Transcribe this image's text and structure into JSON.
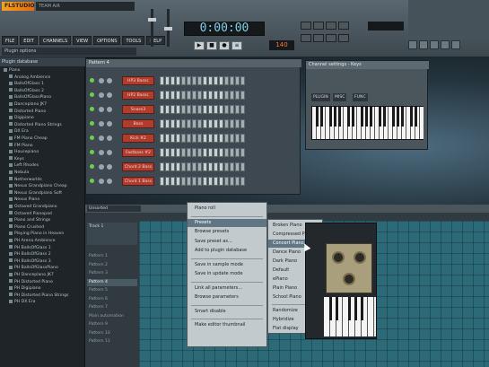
{
  "app": {
    "logo": "FLSTUDIO",
    "song_name": "TEAM AiR",
    "hint": "Plugin options"
  },
  "menu": [
    "FILE",
    "EDIT",
    "CHANNELS",
    "VIEW",
    "OPTIONS",
    "TOOLS",
    "HELP"
  ],
  "transport": {
    "time": "0:00:00",
    "buttons": [
      "▶",
      "■",
      "●",
      "≡"
    ],
    "tempo": "140"
  },
  "browser": {
    "header": "Plugin database",
    "items": [
      "Piano",
      "Analog Ambience",
      "BallsOfGlass 1",
      "BallsOfGlass 2",
      "BallsOfGlassPiano",
      "Danceplano JK7",
      "Distorted Piano",
      "Digipiano",
      "Distorted Piano Strings",
      "DX Era",
      "FM Piano Cheap",
      "FM Piano",
      "Housepiano",
      "Keys",
      "Left Rhodes",
      "Nebula",
      "Netherworlds",
      "Nexus Grandpiano Cheap",
      "Nexus Grandpiano Soft",
      "Nexus Piano",
      "Octaved Grandpiano",
      "Octaved Pianopad",
      "Piano and Strings",
      "Piano Crushed",
      "Playing Piano in Heaven",
      "PH Arena Ambience",
      "PH BallsOfGlass 1",
      "PH BallsOfGlass 2",
      "PH BallsOfGlass 3",
      "PH BallsOfGlassPiano",
      "PH Danceplano JK7",
      "PH Distorted Piano",
      "PH Digipiano",
      "PH Distorted Piano Strings",
      "PH DX Era"
    ]
  },
  "stepseq": {
    "title": "Pattern 4",
    "channels": [
      "HP3 Bassc",
      "HP2 Bassc",
      "Snare3",
      "Bass",
      "Kick #2",
      "Fastbass #2",
      "Chord 2 Bass",
      "Chord 1 Bass"
    ]
  },
  "channel_settings": {
    "title": "Channel settings - Keys",
    "tabs": [
      "PLUGIN",
      "MISC",
      "FUNC"
    ]
  },
  "playlist": {
    "dropdown": "Unsorted",
    "track1": "Track 1",
    "patterns": [
      "Pattern 1",
      "Pattern 2",
      "Pattern 3",
      "Pattern 4",
      "Pattern 5",
      "Pattern 6",
      "Pattern 7",
      "Main automation",
      "Pattern 9",
      "Pattern 10",
      "Pattern 11"
    ],
    "selected_pattern_index": 3
  },
  "context_menu": {
    "items": [
      "Piano roll",
      "",
      "Presets",
      "Browse presets",
      "Save preset as...",
      "Add to plugin database",
      "",
      "Save in sample mode",
      "Save in update mode",
      "",
      "Link all parameters...",
      "Browse parameters",
      "",
      "Smart disable",
      "",
      "Make editor thumbnail"
    ],
    "highlight_index": 2
  },
  "submenu": {
    "items": [
      "Broken Piano",
      "Compressed Piano",
      "Concert Piano",
      "Dance Piano",
      "Dark Piano",
      "Default",
      "ePiano",
      "Plain Piano",
      "School Piano",
      "",
      "Randomize",
      "Hybridize",
      "Flat display"
    ],
    "highlight_index": 2
  }
}
